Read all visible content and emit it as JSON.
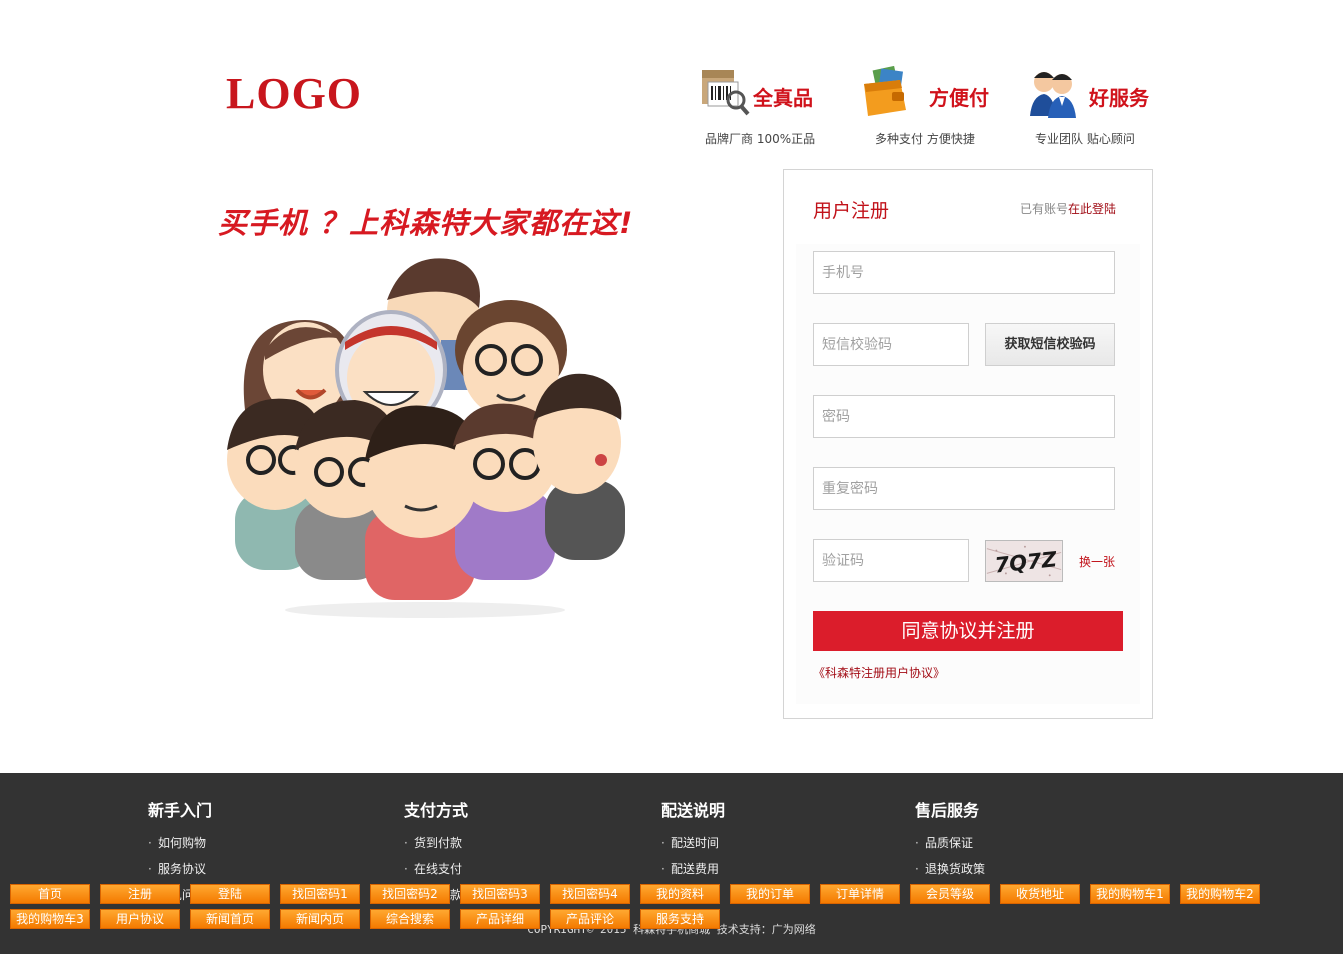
{
  "header": {
    "logo": "LOGO",
    "features": [
      {
        "title": "全真品",
        "sub": "品牌厂商  100%正品",
        "icon": "barcode-box-icon"
      },
      {
        "title": "方便付",
        "sub": "多种支付   方便快捷",
        "icon": "wallet-icon"
      },
      {
        "title": "好服务",
        "sub": "专业团队   贴心顾问",
        "icon": "service-team-icon"
      }
    ]
  },
  "hero": {
    "slogan": "买手机 ？上科森特大家都在这!"
  },
  "register": {
    "title": "用户注册",
    "have_account": "已有账号",
    "login_link": "在此登陆",
    "phone_placeholder": "手机号",
    "sms_placeholder": "短信校验码",
    "sms_button": "获取短信校验码",
    "password_placeholder": "密码",
    "repeat_placeholder": "重复密码",
    "captcha_placeholder": "验证码",
    "captcha_refresh": "换一张",
    "submit": "同意协议并注册",
    "agreement": "《科森特注册用户协议》"
  },
  "footer": {
    "columns": [
      {
        "title": "新手入门",
        "items": [
          "如何购物",
          "服务协议",
          "常见问题"
        ]
      },
      {
        "title": "支付方式",
        "items": [
          "货到付款",
          "在线支付",
          "分期付款"
        ]
      },
      {
        "title": "配送说明",
        "items": [
          "配送时间",
          "配送费用",
          "配送范围"
        ]
      },
      {
        "title": "售后服务",
        "items": [
          "品质保证",
          "退换货政策",
          "退换货流程"
        ]
      }
    ],
    "copyright": "COPYRIGHT© 2015 科森特手机商城 技术支持：广为网络"
  },
  "nav": {
    "row1": [
      "首页",
      "注册",
      "登陆",
      "找回密码1",
      "找回密码2",
      "找回密码3",
      "找回密码4",
      "我的资料",
      "我的订单",
      "订单详情",
      "会员等级",
      "收货地址",
      "我的购物车1",
      "我的购物车2"
    ],
    "row2": [
      "我的购物车3",
      "用户协议",
      "新闻首页",
      "新闻内页",
      "综合搜索",
      "产品详细",
      "产品评论",
      "服务支持"
    ]
  },
  "colors": {
    "brand_red": "#d71921",
    "footer_bg": "#333333",
    "nav_orange": "#f47a00"
  }
}
